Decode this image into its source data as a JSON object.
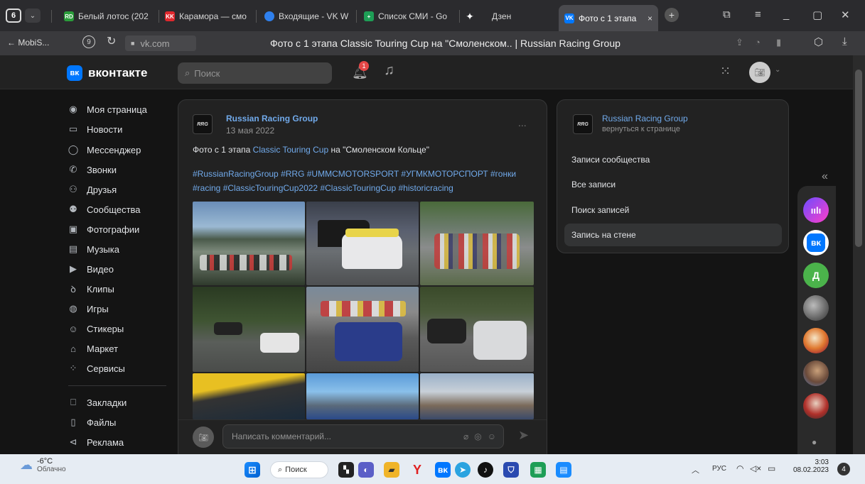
{
  "browser": {
    "tab_count": "6",
    "tabs": [
      {
        "label": "Белый лотос (202",
        "badge": "RD",
        "color": "#2a9d3a"
      },
      {
        "label": "Карамора — смо",
        "badge": "KK",
        "color": "#e0282d"
      },
      {
        "label": "Входящие - VK W",
        "badge": "",
        "color": "#2f80ed"
      },
      {
        "label": "Список СМИ - Go",
        "badge": "+",
        "color": "#1e9e56"
      },
      {
        "label": "Дзен",
        "badge": "✦",
        "color": "#2b2b2e"
      },
      {
        "label": "Фото с 1 этапа",
        "badge": "VK",
        "color": "#0077ff"
      }
    ],
    "back_label": "← MobiS...",
    "domain": "vk.com",
    "page_title": "Фото с 1 этапа Classic Touring Cup на \"Смоленском.. | Russian Racing Group"
  },
  "vk": {
    "logo_text": "вконтакте",
    "search_placeholder": "Поиск",
    "notification_count": "1"
  },
  "menu": {
    "items": [
      "Моя страница",
      "Новости",
      "Мессенджер",
      "Звонки",
      "Друзья",
      "Сообщества",
      "Фотографии",
      "Музыка",
      "Видео",
      "Клипы",
      "Игры",
      "Стикеры",
      "Маркет",
      "Сервисы"
    ],
    "items2": [
      "Закладки",
      "Файлы",
      "Реклама"
    ]
  },
  "post": {
    "author": "Russian Racing Group",
    "date": "13 мая 2022",
    "text_prefix": "Фото с 1 этапа ",
    "text_link": "Classic Touring Cup",
    "text_suffix": " на \"Смоленском Кольце\"",
    "hashtags_line1": "#RussianRacingGroup #RRG #UMMCMOTORSPORT #УГМКМОТОРСПОРТ #гонки",
    "hashtags_line2": "#racing #ClassicTouringCup2022 #ClassicTouringCup #historicracing",
    "more": "...",
    "comment_placeholder": "Написать комментарий..."
  },
  "right_card": {
    "group_name": "Russian Racing Group",
    "back_link": "вернуться к странице",
    "items": [
      "Записи сообщества",
      "Все записи",
      "Поиск записей",
      "Запись на стене"
    ]
  },
  "side": {
    "collapse": "«",
    "avatar_letter": "Д"
  },
  "taskbar": {
    "temp": "-6°C",
    "weather": "Облачно",
    "search": "Поиск",
    "lang": "РУС",
    "time": "3:03",
    "date": "08.02.2023",
    "notif": "4"
  }
}
